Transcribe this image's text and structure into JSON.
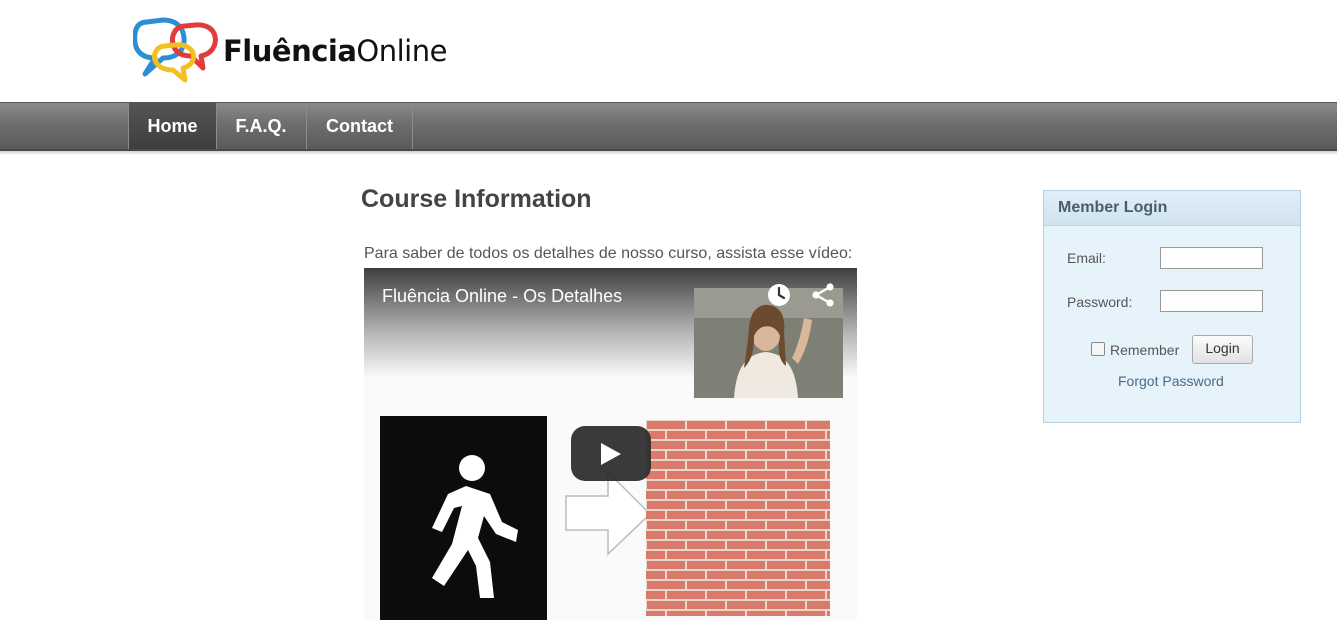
{
  "brand": {
    "name_bold": "Fluência",
    "name_light": "Online",
    "colors": {
      "blue": "#2b8fd6",
      "red": "#e23b3b",
      "yellow": "#f4c020"
    }
  },
  "nav": {
    "items": [
      {
        "label": "Home",
        "active": true
      },
      {
        "label": "F.A.Q.",
        "active": false
      },
      {
        "label": "Contact",
        "active": false
      }
    ]
  },
  "main": {
    "title": "Course Information",
    "intro": "Para saber de todos os detalhes de nosso curso, assista esse vídeo:",
    "video": {
      "title": "Fluência Online - Os Detalhes",
      "icons": [
        "clock-icon",
        "share-icon",
        "play-icon"
      ]
    }
  },
  "login": {
    "title": "Member Login",
    "email_label": "Email:",
    "password_label": "Password:",
    "email_value": "",
    "password_value": "",
    "remember_label": "Remember",
    "remember_checked": false,
    "button_label": "Login",
    "forgot_label": "Forgot Password"
  }
}
